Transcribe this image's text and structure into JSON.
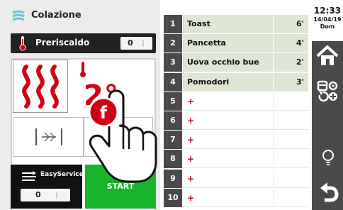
{
  "program": {
    "title": "Colazione",
    "icon": "steam-icon"
  },
  "preheat": {
    "label": "Preriscaldo",
    "value": "0",
    "icon": "thermometer-icon"
  },
  "heating": {
    "mode_icon": "top-bottom-heat-icon",
    "temperature": "2",
    "unit": "°",
    "fan_icon": "fan-icon"
  },
  "easy_service": {
    "label": "EasyService",
    "value": "0",
    "icon": "easyservice-icon"
  },
  "start": {
    "label": "START"
  },
  "overlay": {
    "badge": "f",
    "badge_icon": "touch-hand-icon"
  },
  "phases": [
    {
      "num": "1",
      "name": "Toast",
      "time": "6'"
    },
    {
      "num": "2",
      "name": "Pancetta",
      "time": "4'"
    },
    {
      "num": "3",
      "name": "Uova occhio bue",
      "time": "2'"
    },
    {
      "num": "4",
      "name": "Pomodori",
      "time": "3'"
    },
    {
      "num": "5",
      "name": "+",
      "time": ""
    },
    {
      "num": "6",
      "name": "+",
      "time": ""
    },
    {
      "num": "7",
      "name": "+",
      "time": ""
    },
    {
      "num": "8",
      "name": "+",
      "time": ""
    },
    {
      "num": "9",
      "name": "+",
      "time": ""
    },
    {
      "num": "10",
      "name": "+",
      "time": ""
    }
  ],
  "clock": {
    "time": "12:33",
    "date": "14/04/19",
    "day": "Dom"
  },
  "nav": [
    "home-icon",
    "program-settings-icon",
    "lightbulb-icon",
    "back-icon"
  ],
  "colors": {
    "accent_red": "#d20014",
    "start_green": "#16b32b",
    "dark": "#4a4a4a",
    "row_fill": "#dfe6d6"
  }
}
